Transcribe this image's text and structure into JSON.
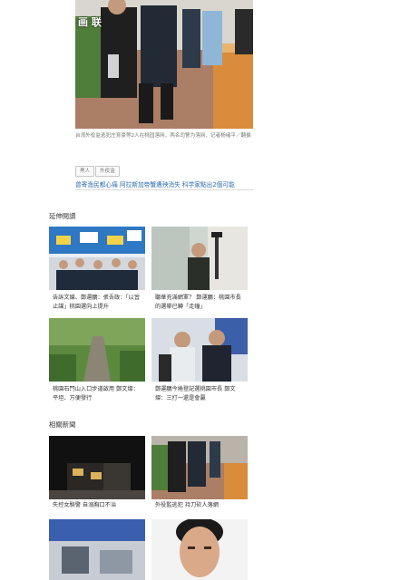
{
  "article": {
    "photo_label": "画 联",
    "caption": "台湾外役监逃犯庄育豪等2人在桃园落网，两名司警为落网，记者杨绪平／翻摄",
    "tags": [
      "黑人",
      "外役监"
    ],
    "promo_link": "曾寄渔民都心痛 阿拉斯加帝蟹遭殃消失 科学家點出2個可能"
  },
  "sections": {
    "extended_reading": {
      "title": "延伸閱讀",
      "cards": [
        {
          "title": "告訴文媒、鄭運鵬：張吾政：「以習止謀」桃園選向上提升"
        },
        {
          "title": "聽華充滿網軍？ 鄭運鵬：桃園市長的選舉已轉「走鐘」"
        },
        {
          "title": "桃園石門山入口步道啟用 鄭文燦：平坦、方便發行"
        },
        {
          "title": "鄭運鵬今捲登記選桃園市長 鄭文燦：三打一還是會贏"
        }
      ]
    },
    "related_news": {
      "title": "相關新聞",
      "cards": [
        {
          "title": "失控女騎警 自溺胸口不治"
        },
        {
          "title": "外役監逃犯 持刀砍人落網"
        },
        {
          "title": ""
        },
        {
          "title": ""
        }
      ]
    }
  }
}
